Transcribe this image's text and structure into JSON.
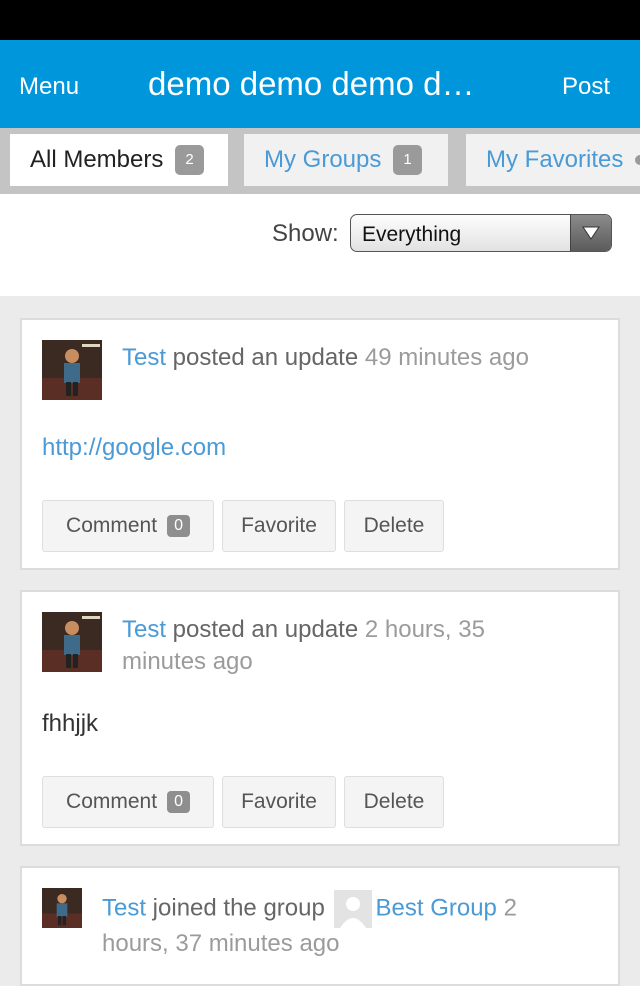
{
  "nav": {
    "menu_label": "Menu",
    "title": "demo demo demo d…",
    "post_label": "Post"
  },
  "tabs": [
    {
      "label": "All Members",
      "count": "2",
      "active": true
    },
    {
      "label": "My Groups",
      "count": "1",
      "active": false
    },
    {
      "label": "My Favorites",
      "count": "",
      "active": false
    }
  ],
  "filter": {
    "label": "Show:",
    "selected": "Everything"
  },
  "activities": [
    {
      "user": "Test",
      "action": " posted an update ",
      "time": "49 minutes ago",
      "content": "http://google.com",
      "comment_label": "Comment",
      "comment_count": "0",
      "favorite_label": "Favorite",
      "delete_label": "Delete"
    },
    {
      "user": "Test",
      "action": " posted an update ",
      "time": "2 hours, 35 minutes ago",
      "content": "fhhjjk",
      "comment_label": "Comment",
      "comment_count": "0",
      "favorite_label": "Favorite",
      "delete_label": "Delete"
    },
    {
      "user": "Test",
      "action": " joined the group ",
      "group": "Best Group",
      "time": " 2 hours, 37 minutes ago"
    }
  ],
  "colors": {
    "brand": "#0096db",
    "link": "#4a9ad6"
  }
}
